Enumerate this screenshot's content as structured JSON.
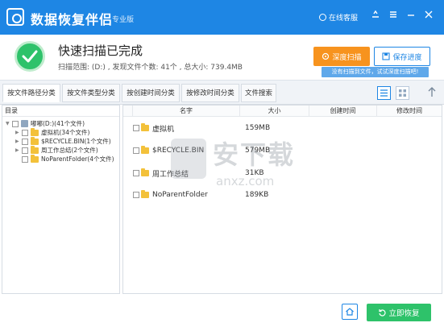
{
  "app": {
    "title": "数据恢复伴侣",
    "edition": "专业版",
    "support_label": "在线客服"
  },
  "status": {
    "title": "快速扫描已完成",
    "detail": "扫描范围: (D:) , 发现文件个数: 41个 , 总大小: 739.4MB"
  },
  "actions": {
    "deep_scan_label": "深度扫描",
    "save_progress_label": "保存进度",
    "tip": "没有扫描到文件，试试深度扫描吧!"
  },
  "tabs": [
    {
      "label": "按文件路径分类"
    },
    {
      "label": "按文件类型分类"
    },
    {
      "label": "按创建时间分类"
    },
    {
      "label": "按修改时间分类"
    },
    {
      "label": "文件搜索"
    }
  ],
  "tree": {
    "header": "目录",
    "root": "嘟嘟(D:)(41个文件)",
    "children": [
      {
        "label": "虚拟机(34个文件)"
      },
      {
        "label": "$RECYCLE.BIN(1个文件)"
      },
      {
        "label": "周工作总结(2个文件)"
      },
      {
        "label": "NoParentFolder(4个文件)"
      }
    ]
  },
  "file_table": {
    "columns": [
      "名字",
      "大小",
      "创建时间",
      "修改时间"
    ],
    "rows": [
      {
        "name": "虚拟机",
        "size": "159MB"
      },
      {
        "name": "$RECYCLE.BIN",
        "size": "579MB"
      },
      {
        "name": "周工作总结",
        "size": "31KB"
      },
      {
        "name": "NoParentFolder",
        "size": "189KB"
      }
    ]
  },
  "watermark": {
    "text": "安下载",
    "domain": "anxz.com"
  },
  "footer": {
    "restore_label": "立即恢复"
  },
  "colors": {
    "brand_blue": "#1e86e4",
    "success_green": "#2ec26a",
    "deep_scan_orange": "#f7931e"
  }
}
